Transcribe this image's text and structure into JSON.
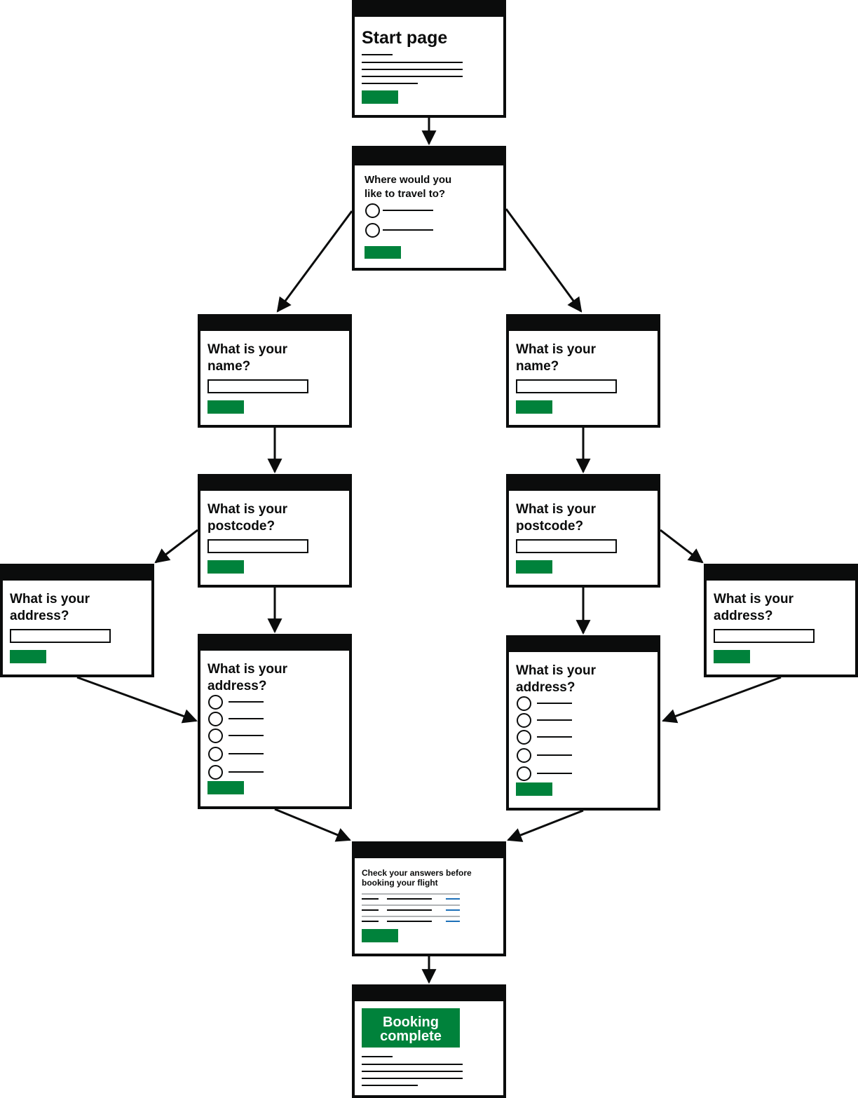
{
  "start": {
    "heading": "Start page"
  },
  "travel": {
    "question": "Where would you like to travel to?"
  },
  "left": {
    "name_q": "What is your name?",
    "postcode_q": "What is your postcode?",
    "address_manual_q": "What is your address?",
    "address_select_q": "What is your address?"
  },
  "right": {
    "name_q": "What is your name?",
    "postcode_q": "What is your postcode?",
    "address_manual_q": "What is your address?",
    "address_select_q": "What is your address?"
  },
  "check": {
    "heading": "Check your answers before booking your flight"
  },
  "complete": {
    "panel_title": "Booking complete"
  },
  "colors": {
    "button": "#00823b",
    "ink": "#0b0c0c",
    "link": "#1d70b8",
    "rule": "#b1b4b6"
  }
}
